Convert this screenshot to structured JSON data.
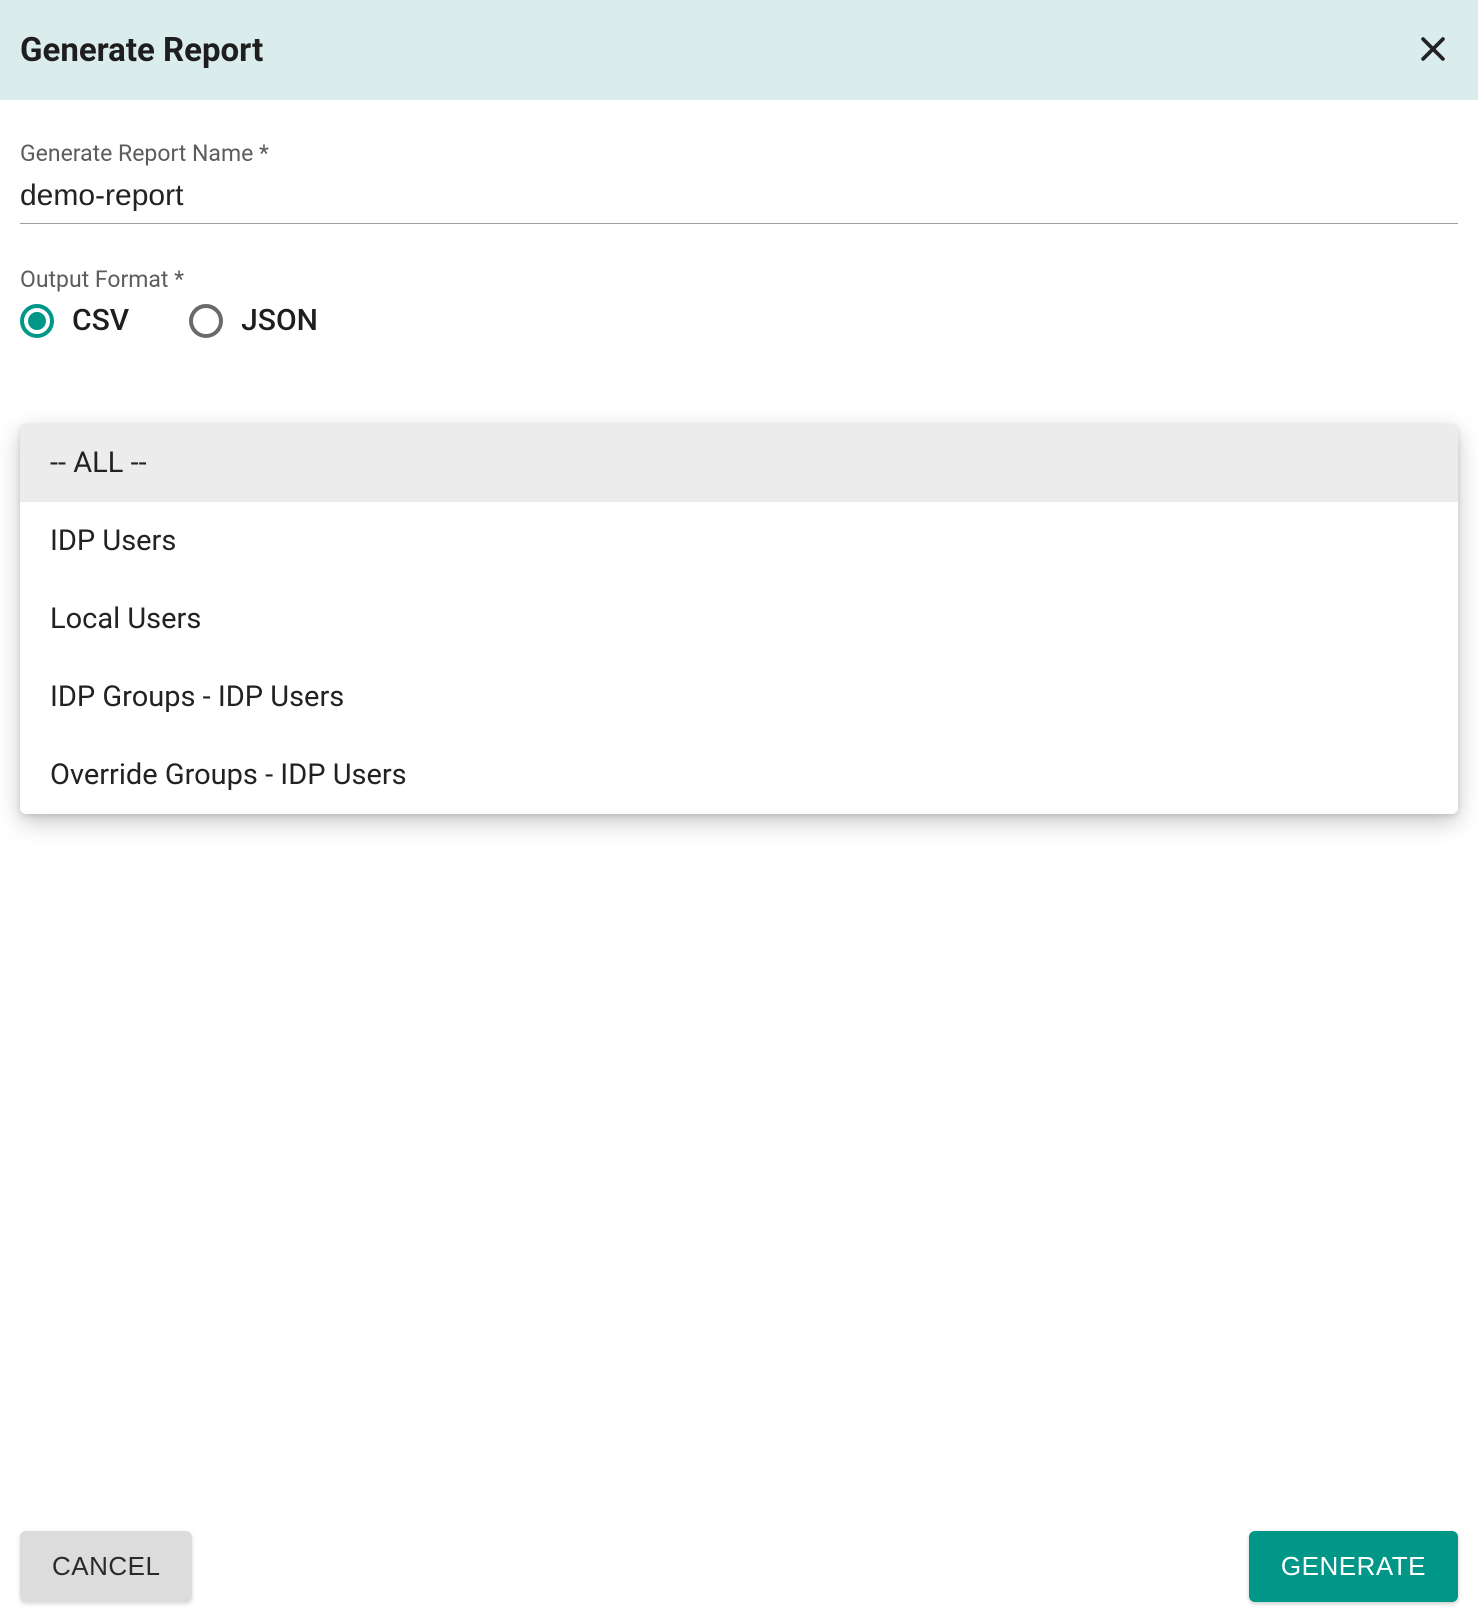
{
  "header": {
    "title": "Generate Report"
  },
  "fields": {
    "name": {
      "label": "Generate Report Name *",
      "value": "demo-report"
    },
    "output_format": {
      "label": "Output Format *",
      "options": {
        "csv": "CSV",
        "json": "JSON"
      },
      "selected": "CSV"
    },
    "group_type": {
      "label_partial": "",
      "options": [
        "-- ALL --",
        "IDP Users",
        "Local Users",
        "IDP Groups - IDP Users",
        "Override Groups - IDP Users"
      ],
      "highlighted_index": 0
    }
  },
  "footer": {
    "cancel": "CANCEL",
    "generate": "GENERATE"
  },
  "colors": {
    "header_bg": "#daedec",
    "accent": "#009688"
  }
}
